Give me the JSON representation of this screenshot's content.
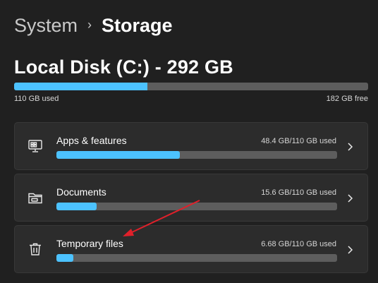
{
  "breadcrumb": {
    "parent": "System",
    "separator": "›",
    "current": "Storage"
  },
  "disk": {
    "title": "Local Disk (C:) - 292 GB",
    "used_label": "110 GB used",
    "free_label": "182 GB free",
    "used_fraction": 0.377
  },
  "categories": [
    {
      "label": "Apps & features",
      "size_label": "48.4 GB/110 GB used",
      "fraction": 0.44,
      "icon": "monitor-apps-icon"
    },
    {
      "label": "Documents",
      "size_label": "15.6 GB/110 GB used",
      "fraction": 0.142,
      "icon": "folder-icon"
    },
    {
      "label": "Temporary files",
      "size_label": "6.68 GB/110 GB used",
      "fraction": 0.06,
      "icon": "trash-icon"
    }
  ],
  "colors": {
    "background": "#202020",
    "card": "#2c2c2c",
    "accent": "#4cc2ff",
    "track": "#5d5d5d",
    "annotation": "#e0202a"
  }
}
